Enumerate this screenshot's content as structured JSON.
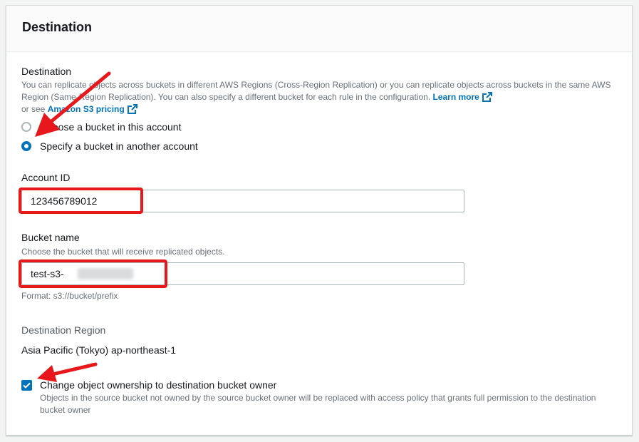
{
  "panel": {
    "title": "Destination"
  },
  "destination": {
    "label": "Destination",
    "description_1": "You can replicate objects across buckets in different AWS Regions (Cross-Region Replication) or you can replicate objects across buckets in the same AWS Region (Same-Region Replication). You can also specify a different bucket for each rule in the configuration.",
    "learn_more_label": "Learn more",
    "description_2": "or see",
    "pricing_link_label": "Amazon S3 pricing",
    "options": [
      {
        "label": "Choose a bucket in this account",
        "selected": false
      },
      {
        "label": "Specify a bucket in another account",
        "selected": true
      }
    ]
  },
  "account_id": {
    "label": "Account ID",
    "value": "123456789012"
  },
  "bucket_name": {
    "label": "Bucket name",
    "description": "Choose the bucket that will receive replicated objects.",
    "value": "test-s3-",
    "hint": "Format: s3://bucket/prefix"
  },
  "destination_region": {
    "label": "Destination Region",
    "value": "Asia Pacific (Tokyo) ap-northeast-1"
  },
  "ownership": {
    "checked": true,
    "label": "Change object ownership to destination bucket owner",
    "description": "Objects in the source bucket not owned by the source bucket owner will be replaced with access policy that grants full permission to the destination bucket owner"
  },
  "colors": {
    "accent": "#0073bb",
    "annotation": "#e8171b"
  },
  "icons": [
    "external-link-icon",
    "checkmark-icon",
    "annotation-arrow"
  ]
}
